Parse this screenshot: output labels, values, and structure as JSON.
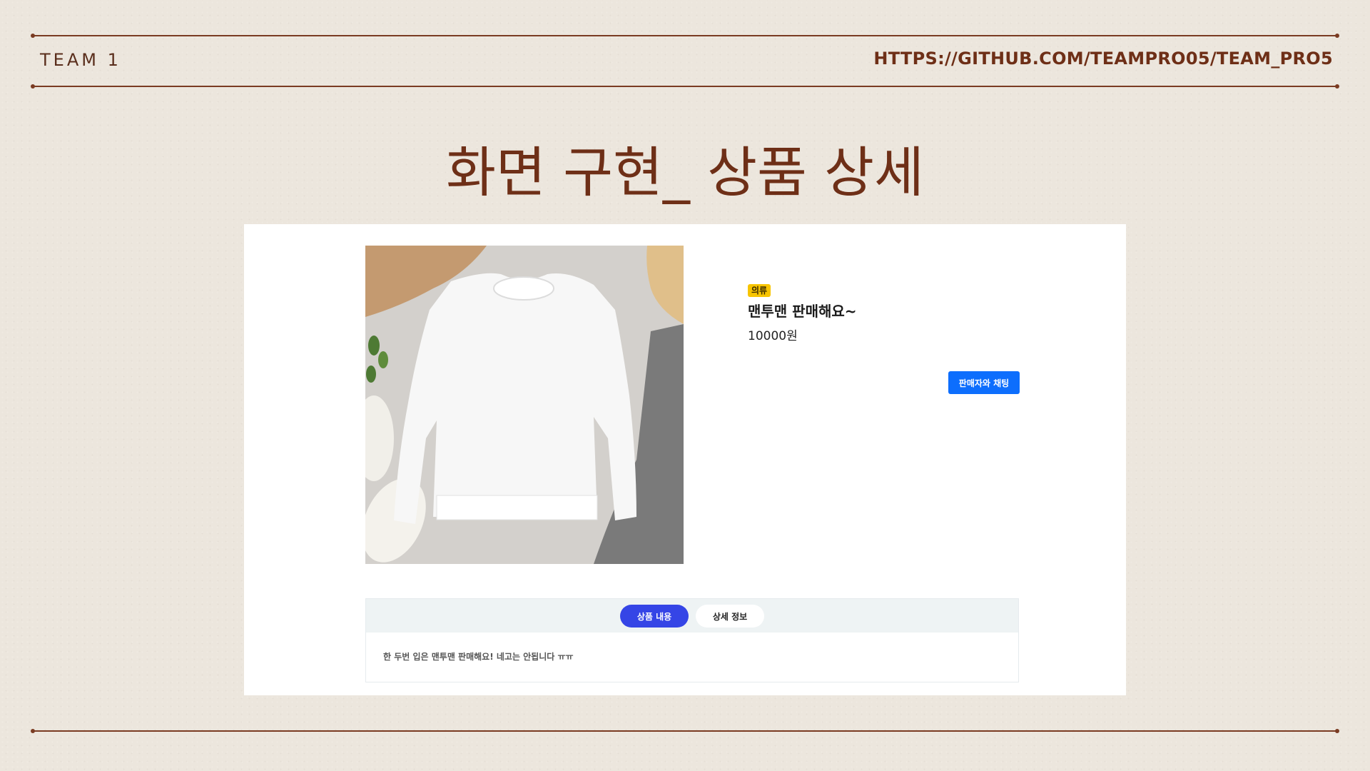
{
  "header": {
    "team_label": "TEAM 1",
    "repo_url": "HTTPS://GITHUB.COM/TEAMPRO05/TEAM_PRO5"
  },
  "slide": {
    "title": "화면 구현_ 상품 상세"
  },
  "product": {
    "category": "의류",
    "title": "맨투맨 판매해요~",
    "price": "10000원",
    "chat_button_label": "판매자와 채팅"
  },
  "tabs": [
    {
      "label": "상품 내용",
      "active": true
    },
    {
      "label": "상세 정보",
      "active": false
    }
  ],
  "description": "한 두번 입은 맨투맨 판매해요! 네고는 안됩니다 ㅠㅠ",
  "colors": {
    "accent_brown": "#6e2f17",
    "chat_button": "#0d6efd",
    "active_tab": "#3545e6",
    "category_badge": "#f7c400"
  }
}
